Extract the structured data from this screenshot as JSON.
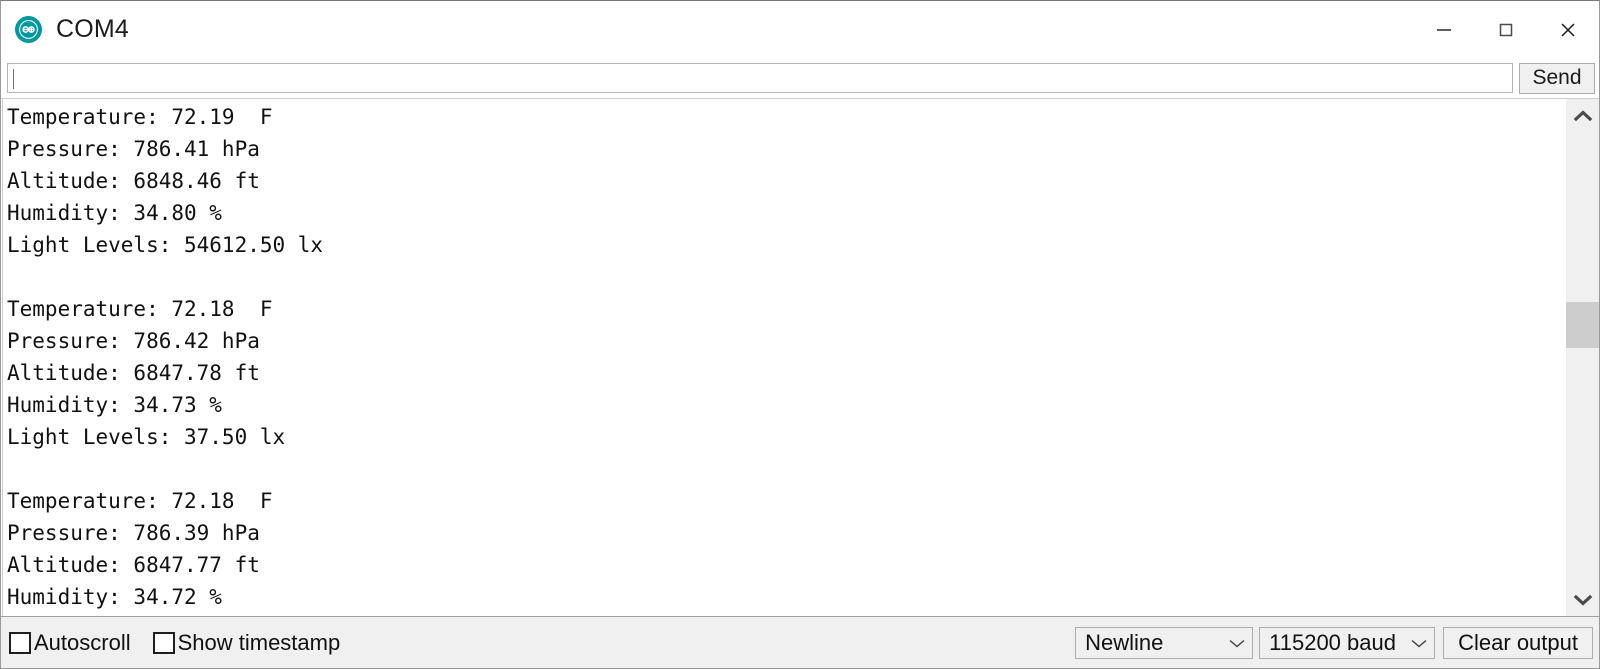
{
  "window": {
    "title": "COM4",
    "logo_icon": "arduino-logo-icon",
    "logo_color": "#00979D",
    "controls": [
      {
        "name": "minimize-button",
        "icon": "minimize-icon"
      },
      {
        "name": "maximize-button",
        "icon": "maximize-icon"
      },
      {
        "name": "close-button",
        "icon": "close-icon"
      }
    ]
  },
  "send_row": {
    "input_value": "",
    "input_placeholder": "",
    "send_label": "Send"
  },
  "console": {
    "lines": [
      "Temperature: 72.19  F",
      "Pressure: 786.41 hPa",
      "Altitude: 6848.46 ft",
      "Humidity: 34.80 %",
      "Light Levels: 54612.50 lx",
      "",
      "Temperature: 72.18  F",
      "Pressure: 786.42 hPa",
      "Altitude: 6847.78 ft",
      "Humidity: 34.73 %",
      "Light Levels: 37.50 lx",
      "",
      "Temperature: 72.18  F",
      "Pressure: 786.39 hPa",
      "Altitude: 6847.77 ft",
      "Humidity: 34.72 %"
    ],
    "readings": [
      {
        "temperature": "72.19",
        "temperature_unit": "F",
        "pressure": "786.41",
        "pressure_unit": "hPa",
        "altitude": "6848.46",
        "altitude_unit": "ft",
        "humidity": "34.80",
        "humidity_unit": "%",
        "light_levels": "54612.50",
        "light_levels_unit": "lx"
      },
      {
        "temperature": "72.18",
        "temperature_unit": "F",
        "pressure": "786.42",
        "pressure_unit": "hPa",
        "altitude": "6847.78",
        "altitude_unit": "ft",
        "humidity": "34.73",
        "humidity_unit": "%",
        "light_levels": "37.50",
        "light_levels_unit": "lx"
      },
      {
        "temperature": "72.18",
        "temperature_unit": "F",
        "pressure": "786.39",
        "pressure_unit": "hPa",
        "altitude": "6847.77",
        "altitude_unit": "ft",
        "humidity": "34.72",
        "humidity_unit": "%"
      }
    ]
  },
  "scrollbar": {
    "up_icon": "chevron-up-icon",
    "down_icon": "chevron-down-icon"
  },
  "status_bar": {
    "autoscroll_label": "Autoscroll",
    "autoscroll_checked": false,
    "timestamp_label": "Show timestamp",
    "timestamp_checked": false,
    "line_ending_value": "Newline",
    "baud_value": "115200 baud",
    "clear_label": "Clear output",
    "dropdown_icon": "chevron-down-icon"
  }
}
